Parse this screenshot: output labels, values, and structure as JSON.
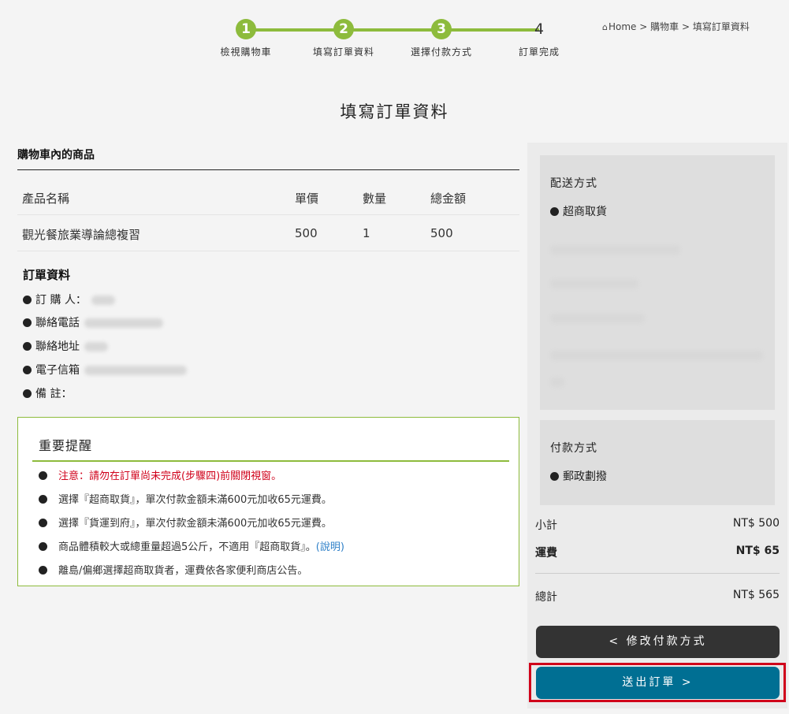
{
  "steps": [
    {
      "num": "1",
      "label": "檢視購物車"
    },
    {
      "num": "2",
      "label": "填寫訂單資料"
    },
    {
      "num": "3",
      "label": "選擇付款方式"
    },
    {
      "num": "4",
      "label": "訂單完成"
    }
  ],
  "breadcrumb": {
    "home": "Home",
    "sep": ">",
    "cart": "購物車",
    "current": "填寫訂單資料"
  },
  "page_title": "填寫訂單資料",
  "cart": {
    "title": "購物車內的商品",
    "headers": [
      "產品名稱",
      "單價",
      "數量",
      "總金額"
    ],
    "rows": [
      {
        "name": "觀光餐旅業導論總複習",
        "price": "500",
        "qty": "1",
        "total": "500"
      }
    ]
  },
  "order_info": {
    "title": "訂單資料",
    "fields": [
      "訂 購 人：",
      "聯絡電話",
      "聯絡地址",
      "電子信箱",
      "備 註："
    ]
  },
  "notice": {
    "title": "重要提醒",
    "items": [
      "注意：請勿在訂單尚未完成(步驟四)前關閉視窗。",
      "選擇『超商取貨』，單次付款金額未滿600元加收65元運費。",
      "選擇『貨運到府』，單次付款金額未滿600元加收65元運費。",
      "商品體積較大或總重量超過5公斤，不適用『超商取貨』。",
      "離島/偏鄉選擇超商取貨者，運費依各家便利商店公告。"
    ],
    "link": "(說明)"
  },
  "shipping": {
    "title": "配送方式",
    "method": "超商取貨"
  },
  "payment": {
    "title": "付款方式",
    "method": "郵政劃撥"
  },
  "summary": {
    "subtotal_label": "小計",
    "subtotal": "NT$ 500",
    "shipping_label": "運費",
    "shipping": "NT$ 65",
    "total_label": "總計",
    "total": "NT$ 565"
  },
  "buttons": {
    "modify": "< 修改付款方式",
    "submit": "送出訂單 >"
  },
  "colors": {
    "accent": "#8dbb3c",
    "submit": "#006f93",
    "dark": "#333333",
    "alert": "#d0021b"
  }
}
